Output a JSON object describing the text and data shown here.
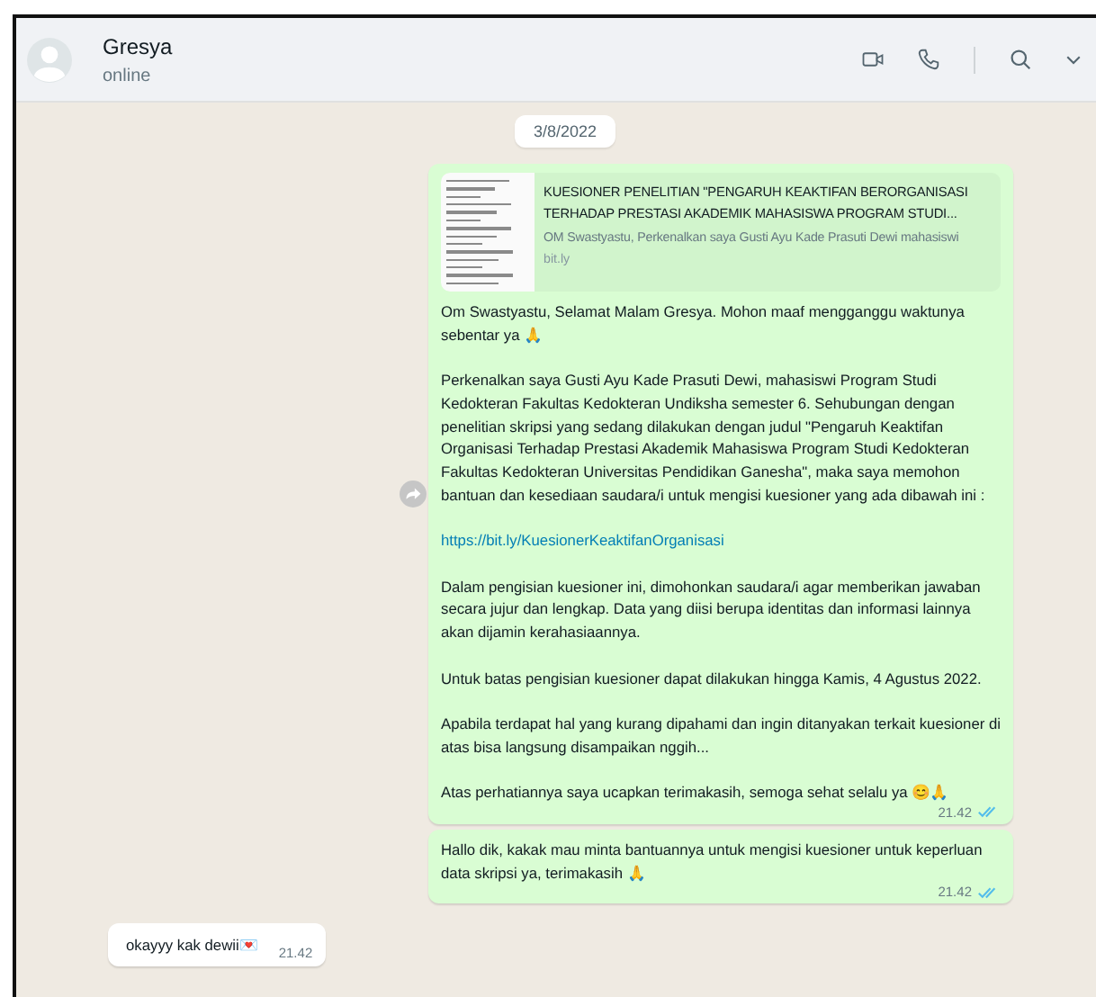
{
  "header": {
    "name": "Gresya",
    "status": "online"
  },
  "date": "3/8/2022",
  "messages": [
    {
      "kind": "outgoing",
      "forward": true,
      "link_preview": {
        "title": "KUESIONER PENELITIAN \"PENGARUH KEAKTIFAN BERORGANISASI TERHADAP PRESTASI AKADEMIK MAHASISWA PROGRAM STUDI...",
        "description": "OM Swastyastu, Perkenalkan saya Gusti Ayu Kade Prasuti Dewi mahasiswi",
        "domain": "bit.ly"
      },
      "paragraphs": [
        {
          "kind": "text",
          "text": "Om Swastyastu, Selamat Malam Gresya. Mohon maaf mengganggu waktunya sebentar ya 🙏"
        },
        {
          "kind": "text",
          "text": "Perkenalkan saya Gusti Ayu Kade Prasuti Dewi, mahasiswi Program Studi Kedokteran Fakultas Kedokteran Undiksha semester 6. Sehubungan dengan penelitian skripsi yang sedang dilakukan dengan judul \"Pengaruh Keaktifan Organisasi Terhadap Prestasi Akademik Mahasiswa Program Studi Kedokteran Fakultas Kedokteran Universitas Pendidikan Ganesha\", maka saya memohon bantuan dan kesediaan saudara/i untuk mengisi kuesioner yang ada dibawah ini :"
        },
        {
          "kind": "link",
          "text": "https://bit.ly/KuesionerKeaktifanOrganisasi"
        },
        {
          "kind": "text",
          "text": "Dalam pengisian kuesioner ini, dimohonkan saudara/i agar memberikan jawaban secara jujur dan lengkap. Data yang diisi berupa identitas dan informasi lainnya akan dijamin kerahasiaannya."
        },
        {
          "kind": "text",
          "text": "Untuk batas pengisian kuesioner dapat dilakukan hingga Kamis, 4 Agustus 2022."
        },
        {
          "kind": "text",
          "text": "Apabila terdapat hal yang kurang dipahami dan ingin ditanyakan terkait kuesioner di atas bisa langsung disampaikan nggih..."
        },
        {
          "kind": "text",
          "text": "Atas perhatiannya saya ucapkan terimakasih, semoga sehat selalu ya 😊🙏"
        }
      ],
      "time": "21.42",
      "read": true
    },
    {
      "kind": "outgoing",
      "forward": false,
      "paragraphs": [
        {
          "kind": "text",
          "text": "Hallo dik, kakak mau minta bantuannya untuk mengisi kuesioner untuk keperluan data skripsi ya, terimakasih 🙏"
        }
      ],
      "time": "21.42",
      "read": true
    },
    {
      "kind": "incoming",
      "paragraphs": [
        {
          "kind": "text",
          "text": "okayyy kak dewii💌"
        }
      ],
      "time": "21.42"
    }
  ]
}
